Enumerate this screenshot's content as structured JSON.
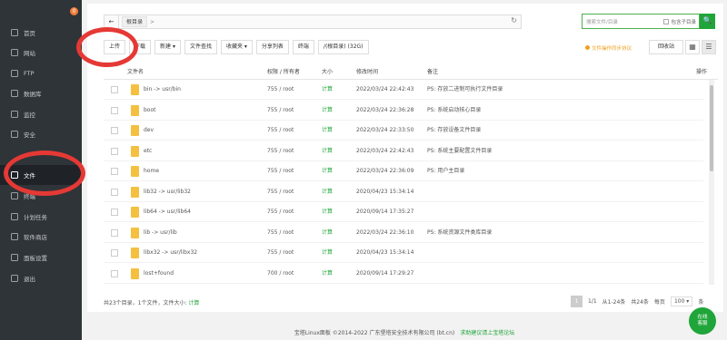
{
  "sidebar": {
    "badge": "0",
    "items": [
      {
        "label": "首页",
        "icon": "home-icon"
      },
      {
        "label": "网站",
        "icon": "globe-icon"
      },
      {
        "label": "FTP",
        "icon": "ftp-icon"
      },
      {
        "label": "数据库",
        "icon": "database-icon"
      },
      {
        "label": "监控",
        "icon": "monitor-icon"
      },
      {
        "label": "安全",
        "icon": "shield-icon"
      },
      {
        "label": "文件",
        "icon": "folder-icon"
      },
      {
        "label": "终端",
        "icon": "terminal-icon"
      },
      {
        "label": "计划任务",
        "icon": "clock-icon"
      },
      {
        "label": "软件商店",
        "icon": "store-icon"
      },
      {
        "label": "面板设置",
        "icon": "gear-icon"
      },
      {
        "label": "退出",
        "icon": "logout-icon"
      }
    ]
  },
  "path": {
    "back": "←",
    "root": "根目录",
    "sep": ">",
    "refresh": "↻"
  },
  "search": {
    "placeholder": "搜索文件/目录",
    "include_sub": "包含子目录",
    "button": "🔍"
  },
  "toolbar": {
    "upload": "上传",
    "download": "下载",
    "new": "新建 ▾",
    "file_search": "文件查找",
    "favorites": "收藏夹 ▾",
    "share_list": "分享列表",
    "terminal": "终端",
    "dir_size": "/(根目录) (32G)"
  },
  "tip": "文件操作同步协议",
  "recycle_bin": "回收站",
  "view": {
    "grid": "▦",
    "list": "☰"
  },
  "table": {
    "headers": {
      "name": "文件名",
      "perm": "权限 / 所有者",
      "size": "大小",
      "mtime": "修改时间",
      "note": "备注",
      "ops": "操作"
    },
    "rows": [
      {
        "name": "bin -> usr/bin",
        "perm": "755 / root",
        "size": "计算",
        "mtime": "2022/03/24 22:42:43",
        "note": "PS: 存放二进制可执行文件目录"
      },
      {
        "name": "boot",
        "perm": "755 / root",
        "size": "计算",
        "mtime": "2022/03/24 22:36:28",
        "note": "PS: 系统启动核心目录"
      },
      {
        "name": "dev",
        "perm": "755 / root",
        "size": "计算",
        "mtime": "2022/03/24 22:33:50",
        "note": "PS: 存放设备文件目录"
      },
      {
        "name": "etc",
        "perm": "755 / root",
        "size": "计算",
        "mtime": "2022/03/24 22:42:43",
        "note": "PS: 系统主要配置文件目录"
      },
      {
        "name": "home",
        "perm": "755 / root",
        "size": "计算",
        "mtime": "2022/03/24 22:36:09",
        "note": "PS: 用户主目录"
      },
      {
        "name": "lib32 -> usr/lib32",
        "perm": "755 / root",
        "size": "计算",
        "mtime": "2020/04/23 15:34:14",
        "note": ""
      },
      {
        "name": "lib64 -> usr/lib64",
        "perm": "755 / root",
        "size": "计算",
        "mtime": "2020/09/14 17:35:27",
        "note": ""
      },
      {
        "name": "lib -> usr/lib",
        "perm": "755 / root",
        "size": "计算",
        "mtime": "2022/03/24 22:36:10",
        "note": "PS: 系统资源文件类库目录"
      },
      {
        "name": "libx32 -> usr/libx32",
        "perm": "755 / root",
        "size": "计算",
        "mtime": "2020/04/23 15:34:14",
        "note": ""
      },
      {
        "name": "lost+found",
        "perm": "700 / root",
        "size": "计算",
        "mtime": "2020/09/14 17:29:27",
        "note": ""
      }
    ]
  },
  "summary": {
    "text": "共23个目录，1个文件，文件大小:",
    "calc": "计算"
  },
  "pager": {
    "current": "1",
    "page_total": "1/1",
    "range": "从1-24条",
    "total": "共24条",
    "per_page_label": "每页",
    "per_page": "100 ▾",
    "unit": "条"
  },
  "footer": {
    "copyright": "宝塔Linux面板 ©2014-2022 广东堡塔安全技术有限公司 (bt.cn)",
    "link": "求助建议请上宝塔论坛"
  },
  "online_service": "在线\n客服",
  "colors": {
    "accent": "#20a53a",
    "sidebar": "#2f3438",
    "annotation": "#e53935",
    "warning": "#f0a020"
  }
}
